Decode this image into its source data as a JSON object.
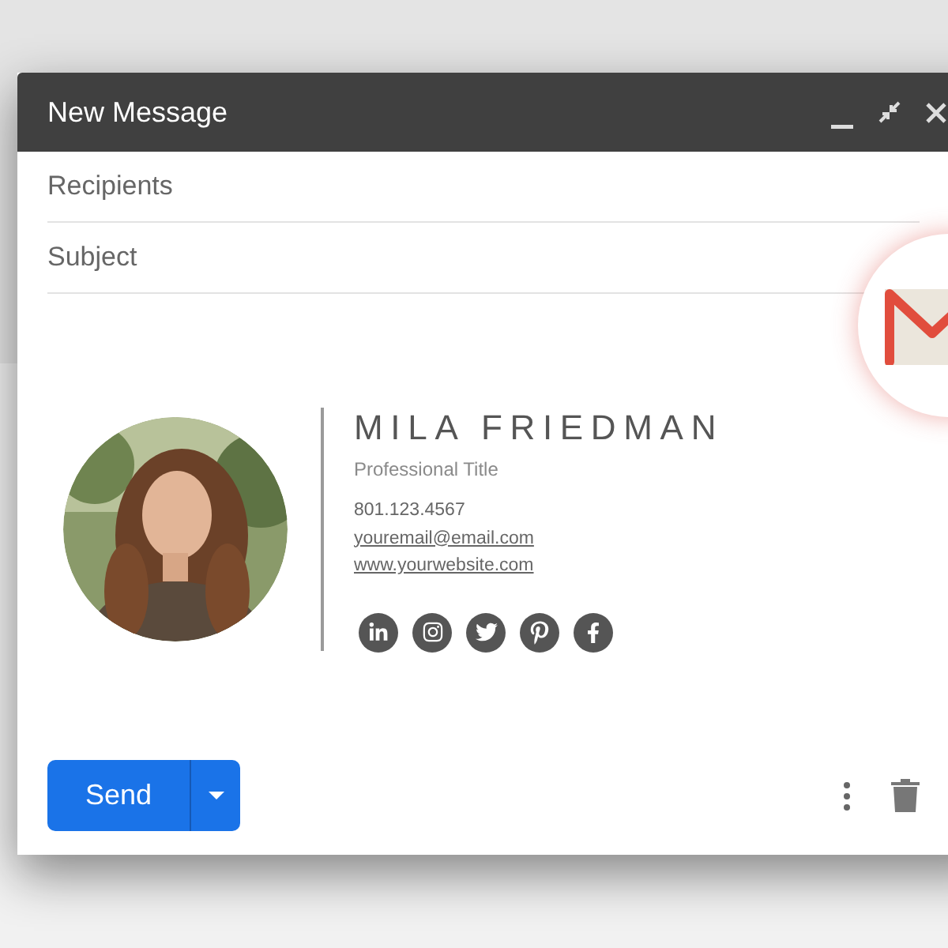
{
  "window": {
    "title": "New Message"
  },
  "fields": [
    {
      "placeholder": "Recipients"
    },
    {
      "placeholder": "Subject"
    }
  ],
  "signature": {
    "name": "MILA FRIEDMAN",
    "title": "Professional Title",
    "phone": "801.123.4567",
    "email": "youremail@email.com",
    "website": "www.yourwebsite.com",
    "social": [
      {
        "kind": "linkedin"
      },
      {
        "kind": "instagram"
      },
      {
        "kind": "twitter"
      },
      {
        "kind": "pinterest"
      },
      {
        "kind": "facebook"
      }
    ]
  },
  "send_button": {
    "label": "Send"
  }
}
